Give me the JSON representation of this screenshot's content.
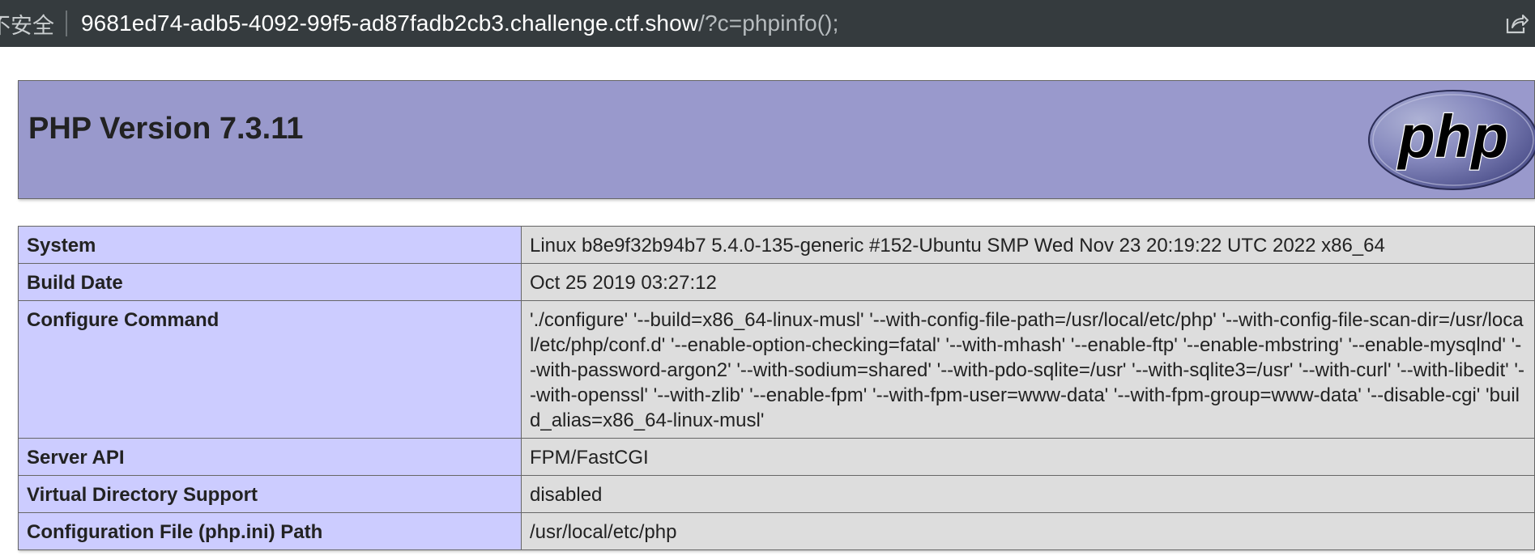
{
  "browser": {
    "security_label": "不安全",
    "url_host": "9681ed74-adb5-4092-99f5-ad87fadb2cb3.challenge.ctf.show",
    "url_path": "/?c=phpinfo();",
    "share_icon": "share-icon"
  },
  "phpinfo": {
    "title": "PHP Version 7.3.11",
    "logo_text": "php",
    "rows": [
      {
        "key": "System",
        "value": "Linux b8e9f32b94b7 5.4.0-135-generic #152-Ubuntu SMP Wed Nov 23 20:19:22 UTC 2022 x86_64"
      },
      {
        "key": "Build Date",
        "value": "Oct 25 2019 03:27:12"
      },
      {
        "key": "Configure Command",
        "value": "'./configure' '--build=x86_64-linux-musl' '--with-config-file-path=/usr/local/etc/php' '--with-config-file-scan-dir=/usr/local/etc/php/conf.d' '--enable-option-checking=fatal' '--with-mhash' '--enable-ftp' '--enable-mbstring' '--enable-mysqlnd' '--with-password-argon2' '--with-sodium=shared' '--with-pdo-sqlite=/usr' '--with-sqlite3=/usr' '--with-curl' '--with-libedit' '--with-openssl' '--with-zlib' '--enable-fpm' '--with-fpm-user=www-data' '--with-fpm-group=www-data' '--disable-cgi' 'build_alias=x86_64-linux-musl'"
      },
      {
        "key": "Server API",
        "value": "FPM/FastCGI"
      },
      {
        "key": "Virtual Directory Support",
        "value": "disabled"
      },
      {
        "key": "Configuration File (php.ini) Path",
        "value": "/usr/local/etc/php"
      }
    ]
  },
  "colors": {
    "header_bg": "#9999cc",
    "key_bg": "#ccccff",
    "value_bg": "#dddddd",
    "addressbar_bg": "#353b3e"
  }
}
